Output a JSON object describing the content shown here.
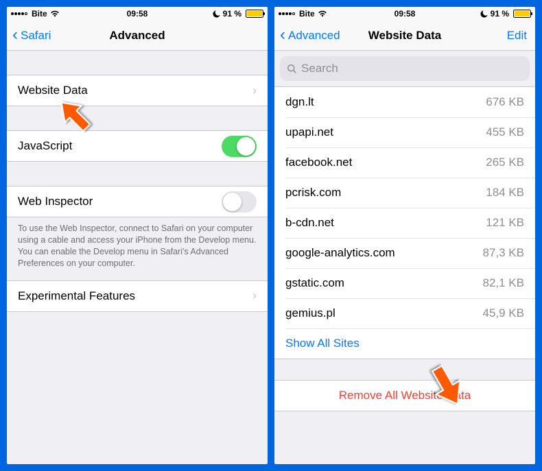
{
  "status": {
    "carrier": "Bite",
    "time": "09:58",
    "battery_pct": "91 %"
  },
  "left": {
    "back_label": "Safari",
    "title": "Advanced",
    "website_data_label": "Website Data",
    "javascript_label": "JavaScript",
    "web_inspector_label": "Web Inspector",
    "inspector_note": "To use the Web Inspector, connect to Safari on your computer using a cable and access your iPhone from the Develop menu. You can enable the Develop menu in Safari's Advanced Preferences on your computer.",
    "experimental_label": "Experimental Features"
  },
  "right": {
    "back_label": "Advanced",
    "title": "Website Data",
    "edit_label": "Edit",
    "search_placeholder": "Search",
    "sites": [
      {
        "host": "dgn.lt",
        "size": "676 KB"
      },
      {
        "host": "upapi.net",
        "size": "455 KB"
      },
      {
        "host": "facebook.net",
        "size": "265 KB"
      },
      {
        "host": "pcrisk.com",
        "size": "184 KB"
      },
      {
        "host": "b-cdn.net",
        "size": "121 KB"
      },
      {
        "host": "google-analytics.com",
        "size": "87,3 KB"
      },
      {
        "host": "gstatic.com",
        "size": "82,1 KB"
      },
      {
        "host": "gemius.pl",
        "size": "45,9 KB"
      }
    ],
    "show_all_label": "Show All Sites",
    "remove_all_label": "Remove All Website Data"
  },
  "annotation": {
    "arrow_color": "#FF5A00"
  }
}
